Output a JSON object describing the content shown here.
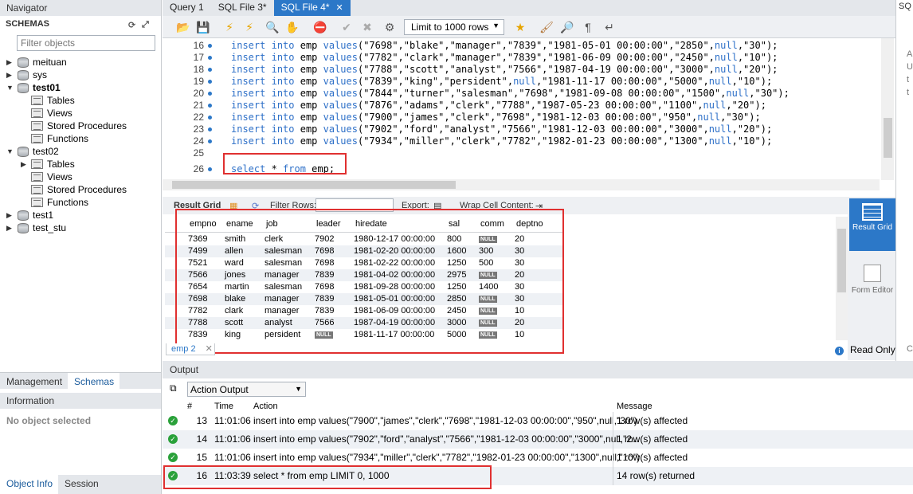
{
  "navigator": {
    "title": "Navigator",
    "schemas_label": "SCHEMAS",
    "filter_placeholder": "Filter objects",
    "tree": [
      {
        "name": "meituan",
        "expanded": false
      },
      {
        "name": "sys",
        "expanded": false
      },
      {
        "name": "test01",
        "expanded": true,
        "bold": true,
        "children": [
          "Tables",
          "Views",
          "Stored Procedures",
          "Functions"
        ]
      },
      {
        "name": "test02",
        "expanded": true,
        "children": [
          "Tables",
          "Views",
          "Stored Procedures",
          "Functions"
        ]
      },
      {
        "name": "test1",
        "expanded": false
      },
      {
        "name": "test_stu",
        "expanded": false
      }
    ],
    "tabs": [
      "Management",
      "Schemas"
    ],
    "active_tab": "Schemas",
    "info_title": "Information",
    "no_object": "No object selected",
    "bottom_tabs": [
      "Object Info",
      "Session"
    ]
  },
  "query_tabs": [
    {
      "label": "Query 1",
      "active": false
    },
    {
      "label": "SQL File 3*",
      "active": false
    },
    {
      "label": "SQL File 4*",
      "active": true
    }
  ],
  "toolbar": {
    "limit_label": "Limit to 1000 rows"
  },
  "editor": {
    "lines": [
      {
        "n": "16",
        "text": "insert into emp values(\"7698\",\"blake\",\"manager\",\"7839\",\"1981-05-01 00:00:00\",\"2850\",null,\"30\");"
      },
      {
        "n": "17",
        "text": "insert into emp values(\"7782\",\"clark\",\"manager\",\"7839\",\"1981-06-09 00:00:00\",\"2450\",null,\"10\");"
      },
      {
        "n": "18",
        "text": "insert into emp values(\"7788\",\"scott\",\"analyst\",\"7566\",\"1987-04-19 00:00:00\",\"3000\",null,\"20\");"
      },
      {
        "n": "19",
        "text": "insert into emp values(\"7839\",\"king\",\"persident\",null,\"1981-11-17 00:00:00\",\"5000\",null,\"10\");"
      },
      {
        "n": "20",
        "text": "insert into emp values(\"7844\",\"turner\",\"salesman\",\"7698\",\"1981-09-08 00:00:00\",\"1500\",null,\"30\");"
      },
      {
        "n": "21",
        "text": "insert into emp values(\"7876\",\"adams\",\"clerk\",\"7788\",\"1987-05-23 00:00:00\",\"1100\",null,\"20\");"
      },
      {
        "n": "22",
        "text": "insert into emp values(\"7900\",\"james\",\"clerk\",\"7698\",\"1981-12-03 00:00:00\",\"950\",null,\"30\");"
      },
      {
        "n": "23",
        "text": "insert into emp values(\"7902\",\"ford\",\"analyst\",\"7566\",\"1981-12-03 00:00:00\",\"3000\",null,\"20\");"
      },
      {
        "n": "24",
        "text": "insert into emp values(\"7934\",\"miller\",\"clerk\",\"7782\",\"1982-01-23 00:00:00\",\"1300\",null,\"10\");"
      },
      {
        "n": "25",
        "text": ""
      },
      {
        "n": "26",
        "text": "select * from emp;"
      }
    ]
  },
  "result": {
    "toolbar": {
      "result_grid": "Result Grid",
      "filter_rows": "Filter Rows:",
      "export": "Export:",
      "wrap": "Wrap Cell Content:"
    },
    "columns": [
      "empno",
      "ename",
      "job",
      "leader",
      "hiredate",
      "sal",
      "comm",
      "deptno"
    ],
    "rows": [
      [
        "7369",
        "smith",
        "clerk",
        "7902",
        "1980-12-17 00:00:00",
        "800",
        null,
        "20"
      ],
      [
        "7499",
        "allen",
        "salesman",
        "7698",
        "1981-02-20 00:00:00",
        "1600",
        "300",
        "30"
      ],
      [
        "7521",
        "ward",
        "salesman",
        "7698",
        "1981-02-22 00:00:00",
        "1250",
        "500",
        "30"
      ],
      [
        "7566",
        "jones",
        "manager",
        "7839",
        "1981-04-02 00:00:00",
        "2975",
        null,
        "20"
      ],
      [
        "7654",
        "martin",
        "salesman",
        "7698",
        "1981-09-28 00:00:00",
        "1250",
        "1400",
        "30"
      ],
      [
        "7698",
        "blake",
        "manager",
        "7839",
        "1981-05-01 00:00:00",
        "2850",
        null,
        "30"
      ],
      [
        "7782",
        "clark",
        "manager",
        "7839",
        "1981-06-09 00:00:00",
        "2450",
        null,
        "10"
      ],
      [
        "7788",
        "scott",
        "analyst",
        "7566",
        "1987-04-19 00:00:00",
        "3000",
        null,
        "20"
      ],
      [
        "7839",
        "king",
        "persident",
        null,
        "1981-11-17 00:00:00",
        "5000",
        null,
        "10"
      ]
    ],
    "null_label": "NULL",
    "tab_label": "emp 2",
    "rail": {
      "result_grid": "Result Grid",
      "form_editor": "Form Editor"
    },
    "read_only": "Read Only"
  },
  "output": {
    "title": "Output",
    "selector": "Action Output",
    "columns": [
      "#",
      "Time",
      "Action",
      "Message"
    ],
    "rows": [
      {
        "n": "13",
        "time": "11:01:06",
        "action": "insert into emp values(\"7900\",\"james\",\"clerk\",\"7698\",\"1981-12-03 00:00:00\",\"950\",null,\"30\")",
        "message": "1 row(s) affected"
      },
      {
        "n": "14",
        "time": "11:01:06",
        "action": "insert into emp values(\"7902\",\"ford\",\"analyst\",\"7566\",\"1981-12-03 00:00:00\",\"3000\",null,\"2...",
        "message": "1 row(s) affected"
      },
      {
        "n": "15",
        "time": "11:01:06",
        "action": "insert into emp values(\"7934\",\"miller\",\"clerk\",\"7782\",\"1982-01-23 00:00:00\",\"1300\",null,\"10\")",
        "message": "1 row(s) affected"
      },
      {
        "n": "16",
        "time": "11:03:39",
        "action": "select * from emp LIMIT 0, 1000",
        "message": "14 row(s) returned"
      }
    ]
  },
  "right_panel": {
    "label": "SQ",
    "letters": [
      "A",
      "U",
      "t",
      "t"
    ],
    "bottom": "Co"
  },
  "colors": {
    "accent": "#2c78c8",
    "highlight_box": "#e03030",
    "keyword": "#2e70c8",
    "success": "#2aa13a"
  }
}
